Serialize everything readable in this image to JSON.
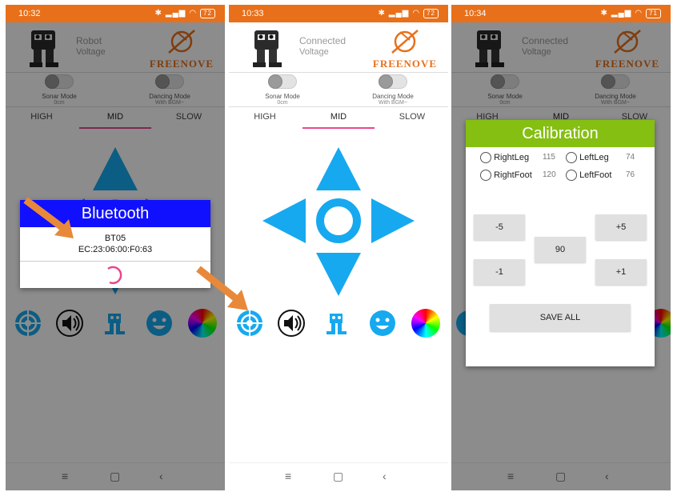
{
  "screens": [
    {
      "time": "10:32",
      "battery": "72",
      "connection_label": "Robot",
      "voltage_label": "Voltage"
    },
    {
      "time": "10:33",
      "battery": "72",
      "connection_label": "Connected",
      "voltage_label": "Voltage"
    },
    {
      "time": "10:34",
      "battery": "71",
      "connection_label": "Connected",
      "voltage_label": "Voltage"
    }
  ],
  "brand": "FREENOVE",
  "modes": {
    "sonar": {
      "label": "Sonar Mode",
      "sub": "0cm"
    },
    "dancing": {
      "label": "Dancing Mode",
      "sub": "With BGM~"
    }
  },
  "speed_tabs": [
    "HIGH",
    "MID",
    "SLOW"
  ],
  "active_speed": "MID",
  "bluetooth_dialog": {
    "title": "Bluetooth",
    "device_name": "BT05",
    "device_mac": "EC:23:06:00:F0:63"
  },
  "calibration_dialog": {
    "title": "Calibration",
    "servos": [
      {
        "label": "RightLeg",
        "value": "115"
      },
      {
        "label": "LeftLeg",
        "value": "74"
      },
      {
        "label": "RightFoot",
        "value": "120"
      },
      {
        "label": "LeftFoot",
        "value": "76"
      }
    ],
    "buttons": {
      "minus5": "-5",
      "plus5": "+5",
      "minus1": "-1",
      "plus1": "+1",
      "center": "90",
      "save": "SAVE ALL"
    }
  },
  "status_icons": {
    "bluetooth": "bluetooth-icon",
    "signal": "signal-icon",
    "wifi": "wifi-icon"
  },
  "colors": {
    "status_orange": "#e8701a",
    "dpad_blue": "#16a9ef",
    "dim_blue": "#11608a",
    "bt_title": "#1010ff",
    "cal_title": "#85bf12",
    "tab_underline": "#e8488c",
    "callout_arrow": "#e8893a"
  }
}
